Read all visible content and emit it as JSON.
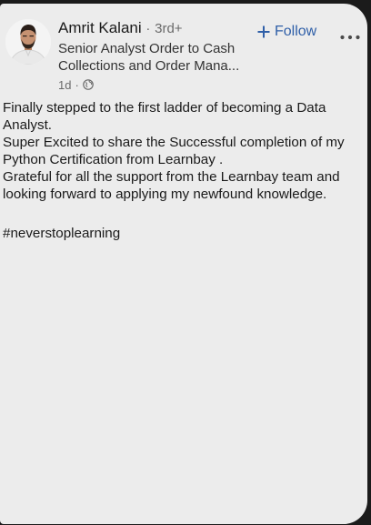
{
  "post": {
    "author": {
      "name": "Amrit Kalani",
      "separator": "·",
      "degree": "3rd+",
      "headline_lines": [
        "Senior Analyst Order to Cash",
        "Collections and Order Mana..."
      ]
    },
    "meta": {
      "age": "1d",
      "separator": "·",
      "visibility_icon": "globe-icon"
    },
    "actions": {
      "follow_label": "Follow",
      "follow_icon": "plus-icon",
      "more_icon": "more-options-icon"
    },
    "body_lines": [
      "Finally stepped to the first ladder of becoming a Data",
      "Analyst.",
      "Super Excited to share the Successful completion of my",
      "Python Certification from Learnbay .",
      "Grateful for all the support from the Learnbay team and",
      "looking forward to applying my newfound knowledge."
    ],
    "hashtag": "#neverstoplearning"
  },
  "colors": {
    "card_background": "#ececec",
    "frame_background": "#1b1b1b",
    "link_blue": "#2f5fa8",
    "text_primary": "#1a1a1a",
    "text_secondary": "#6a6a6a"
  }
}
